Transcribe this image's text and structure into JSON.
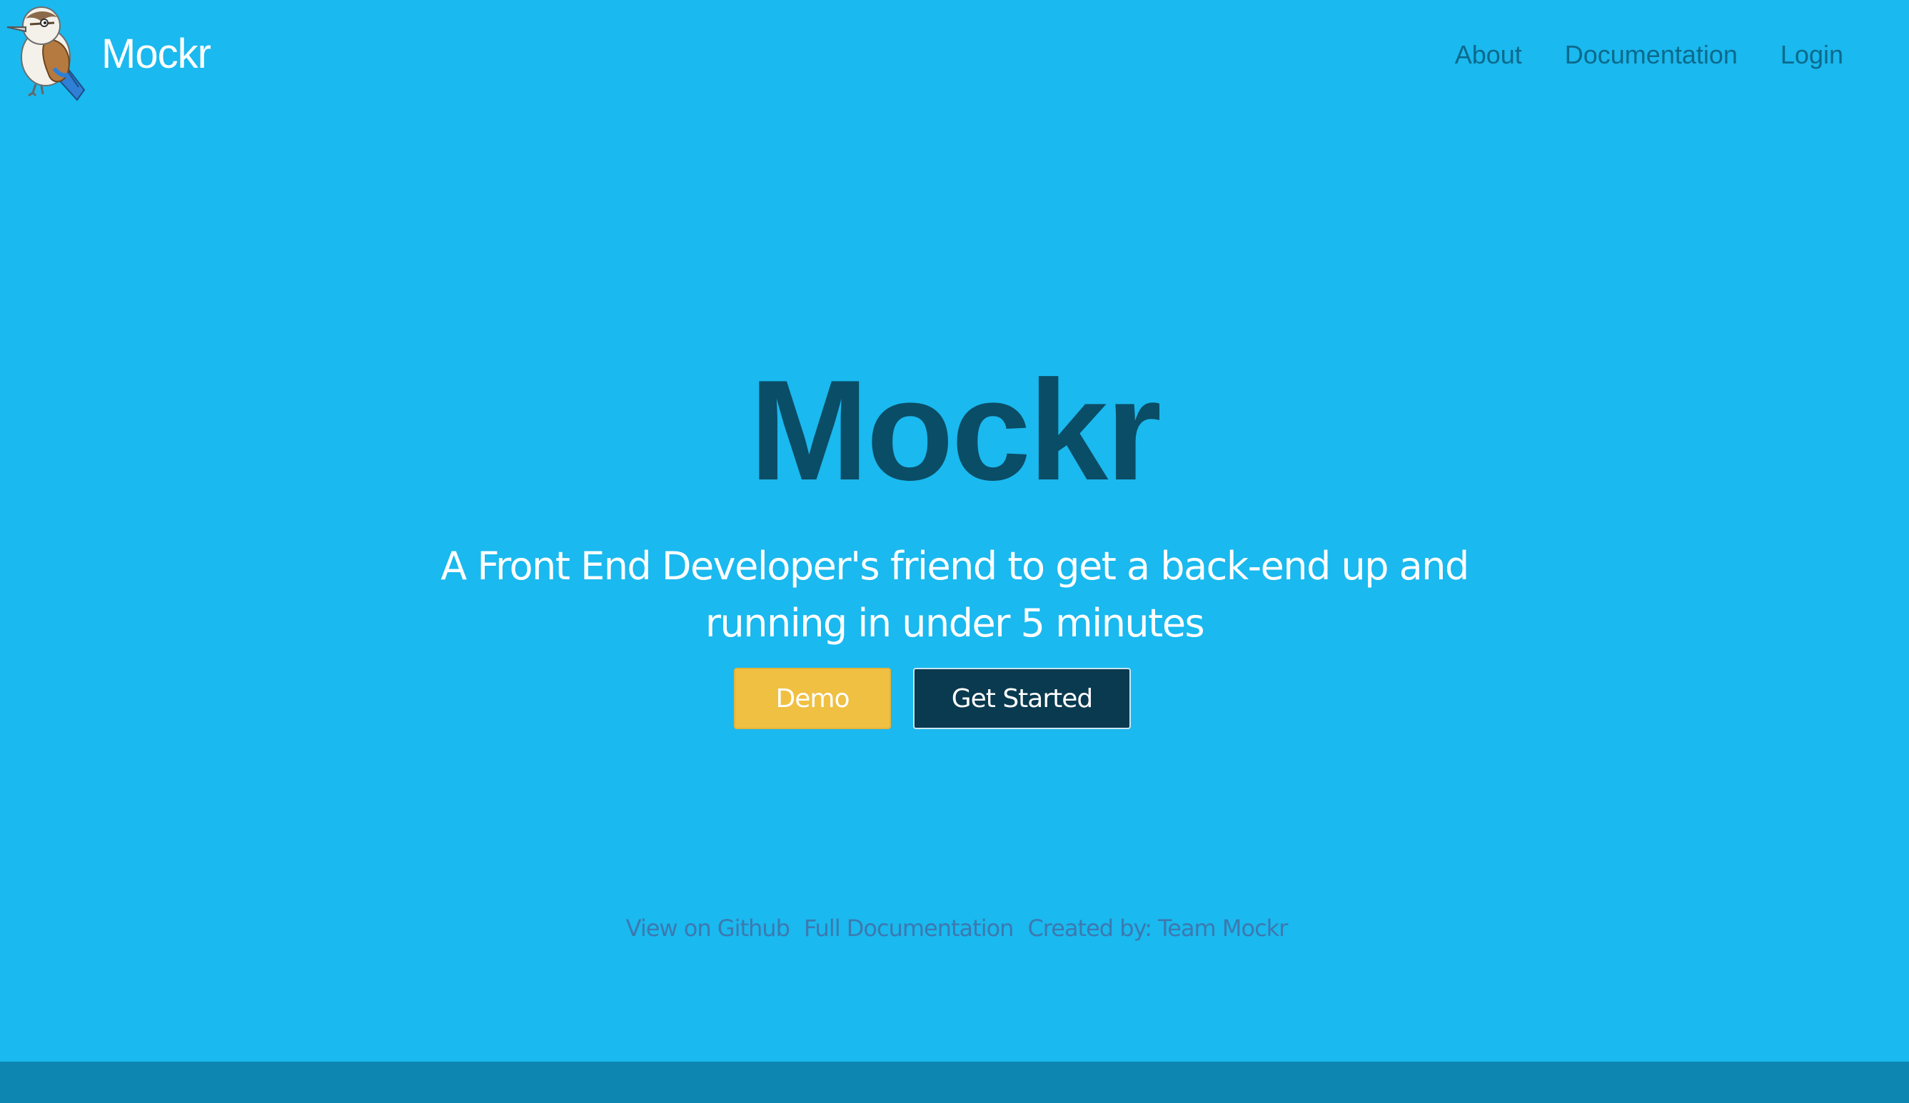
{
  "brand": {
    "name": "Mockr",
    "logo_icon": "kookaburra-logo-icon"
  },
  "nav": {
    "links": [
      {
        "label": "About"
      },
      {
        "label": "Documentation"
      },
      {
        "label": "Login"
      }
    ]
  },
  "hero": {
    "title": "Mockr",
    "tagline": "A Front End Developer's friend to get a back-end up and running in under 5 minutes",
    "demo_label": "Demo",
    "get_started_label": "Get Started"
  },
  "footer": {
    "links": [
      {
        "label": "View on Github"
      },
      {
        "label": "Full Documentation"
      },
      {
        "label": "Created by: Team Mockr"
      }
    ]
  },
  "colors": {
    "background": "#1ab9ef",
    "title": "#0a4d66",
    "nav_link": "#0b6a8c",
    "demo_button": "#f0c042",
    "get_started_button": "#0a3a4f",
    "footer_link": "#3c79b0",
    "bottom_bar": "#0d87b2"
  }
}
